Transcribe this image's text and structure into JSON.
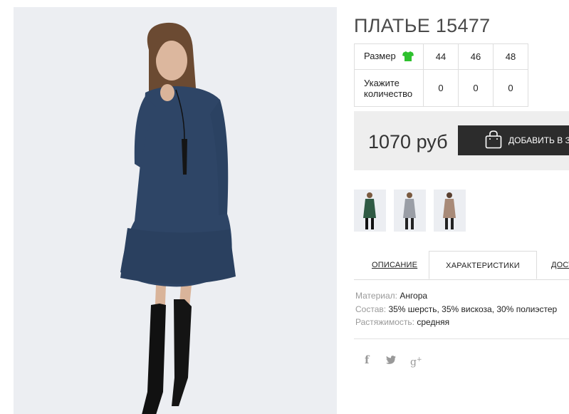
{
  "product": {
    "title": "ПЛАТЬЕ 15477",
    "main_image_alt": "Model wearing dark blue long-sleeve dress with ruffled hem and black knee-high boots"
  },
  "sizes": {
    "size_label": "Размер",
    "size_icon": "tshirt-icon",
    "size_icon_color": "#2ec12e",
    "options": [
      "44",
      "46",
      "48"
    ],
    "quantity_label": "Укажите количество",
    "quantities": [
      "0",
      "0",
      "0"
    ]
  },
  "purchase": {
    "price": "1070 руб",
    "add_to_cart_label": "ДОБАВИТЬ В ЗА",
    "cart_icon": "shopping-bag-icon"
  },
  "thumbnails": [
    {
      "color": "green",
      "swatch": "#2f5a44"
    },
    {
      "color": "grey",
      "swatch": "#9a9ea6"
    },
    {
      "color": "beige",
      "swatch": "#a88a78"
    }
  ],
  "tabs": [
    {
      "label": "ОПИСАНИЕ",
      "active": false
    },
    {
      "label": "ХАРАКТЕРИСТИКИ",
      "active": true
    },
    {
      "label": "ДОСТ",
      "active": false
    }
  ],
  "characteristics": [
    {
      "label": "Материал:",
      "value": "Ангора"
    },
    {
      "label": "Состав:",
      "value": "35% шерсть, 35% вискоза, 30% полиэстер"
    },
    {
      "label": "Растяжимость:",
      "value": "средняя"
    }
  ],
  "social": [
    {
      "name": "facebook-icon",
      "glyph": "f"
    },
    {
      "name": "twitter-icon",
      "glyph": "🐦"
    },
    {
      "name": "google-plus-icon",
      "glyph": "g+"
    }
  ],
  "colors": {
    "dress": "#2e4566",
    "button_bg": "#2c2c2c",
    "price_bar_bg": "#eeeeee"
  }
}
